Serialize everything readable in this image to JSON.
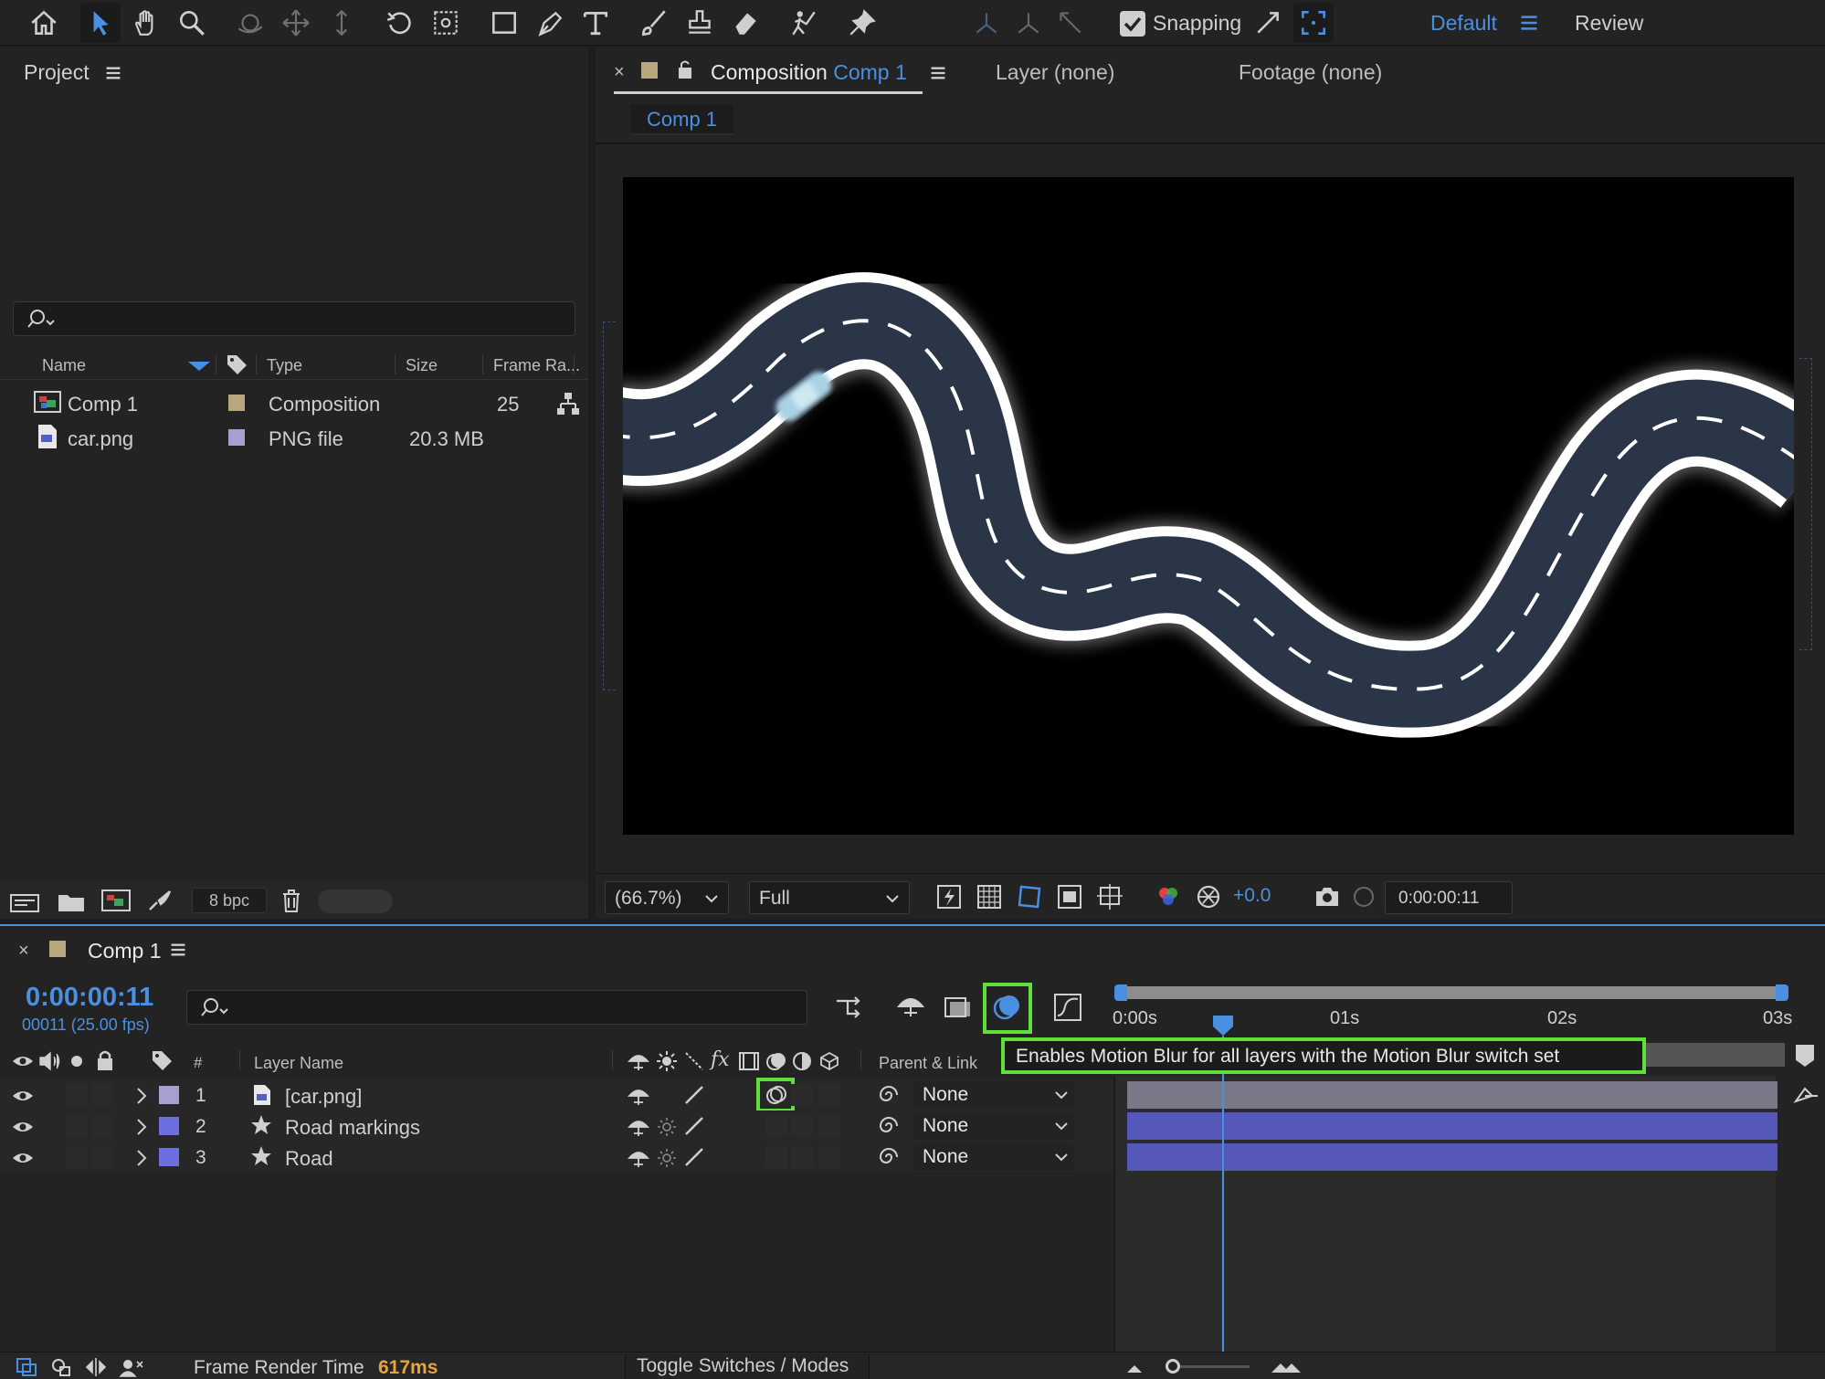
{
  "toolbar": {
    "tools": [
      "home-icon",
      "selection-tool-icon",
      "hand-tool-icon",
      "zoom-tool-icon",
      "orbit-camera-icon",
      "pan-camera-icon",
      "dolly-camera-icon",
      "rotation-tool-icon",
      "pan-behind-tool-icon",
      "rectangle-tool-icon",
      "pen-tool-icon",
      "type-tool-icon",
      "brush-tool-icon",
      "clone-stamp-icon",
      "eraser-tool-icon",
      "roto-brush-icon",
      "puppet-pin-icon"
    ],
    "snapping_label": "Snapping",
    "workspace_default": "Default",
    "workspace_review": "Review"
  },
  "project": {
    "title": "Project",
    "columns": {
      "name": "Name",
      "type": "Type",
      "size": "Size",
      "frame_rate": "Frame Ra..."
    },
    "items": [
      {
        "name": "Comp 1",
        "type": "Composition",
        "size": "",
        "frame_rate": "25",
        "color": "#b8a67e"
      },
      {
        "name": "car.png",
        "type": "PNG file",
        "size": "20.3 MB",
        "frame_rate": "",
        "color": "#a89ed0"
      }
    ],
    "bpc": "8 bpc"
  },
  "viewer": {
    "tab_prefix": "Composition",
    "tab_comp": "Comp 1",
    "layer_tab": "Layer (none)",
    "footage_tab": "Footage (none)",
    "breadcrumb": "Comp 1",
    "zoom": "(66.7%)",
    "resolution": "Full",
    "exposure": "+0.0",
    "timecode": "0:00:00:11"
  },
  "timeline": {
    "tab": "Comp 1",
    "timecode": "0:00:00:11",
    "frame_info": "00011 (25.00 fps)",
    "col_num": "#",
    "col_layer_name": "Layer Name",
    "col_parent": "Parent & Link",
    "ruler": [
      "0:00s",
      "01s",
      "02s",
      "03s"
    ],
    "tooltip": "Enables Motion Blur for all layers with the Motion Blur switch set",
    "layers": [
      {
        "num": "1",
        "name": "[car.png]",
        "parent": "None",
        "color": "#a89ed0"
      },
      {
        "num": "2",
        "name": "Road markings",
        "parent": "None",
        "color": "#6d6fe0"
      },
      {
        "num": "3",
        "name": "Road",
        "parent": "None",
        "color": "#6d6fe0"
      }
    ],
    "frame_render_label": "Frame Render Time",
    "frame_render_value": "617ms",
    "toggle_label": "Toggle Switches / Modes"
  },
  "colors": {
    "accent": "#4a90e2",
    "highlight": "#5ee03a",
    "orange": "#e8a43a",
    "road": "#2a3547"
  }
}
